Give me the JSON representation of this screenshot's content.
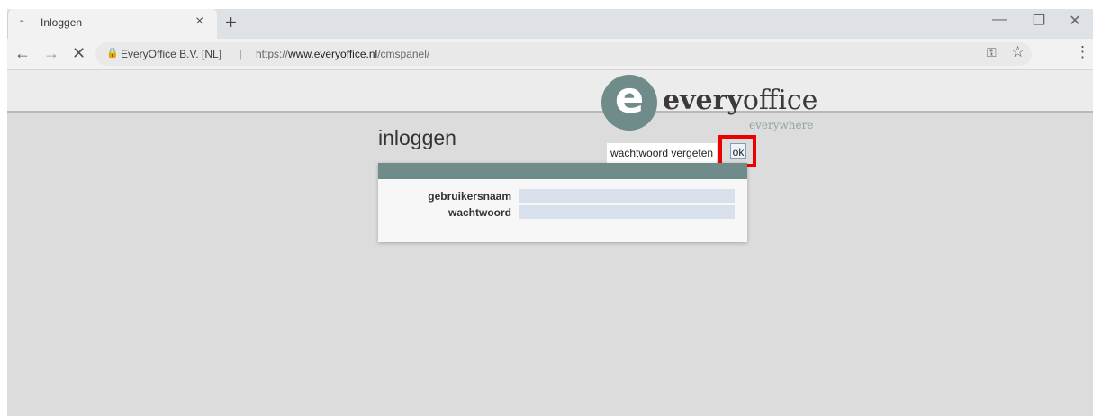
{
  "browser": {
    "tab": {
      "title": "Inloggen"
    },
    "address": {
      "site_identity": "EveryOffice B.V. [NL]",
      "separator": "|",
      "url_scheme": "https://",
      "url_host": "www.everyoffice.nl",
      "url_path": "/cmspanel/"
    },
    "icons": {
      "back": "←",
      "forward": "→",
      "stop": "✕",
      "lock": "🔒",
      "key": "⚿",
      "star": "☆",
      "menu": "⋮",
      "new_tab": "+",
      "tab_close": "×",
      "minimize": "—",
      "restore": "❐",
      "close": "✕",
      "favicon": "⁃"
    }
  },
  "logo": {
    "mark": "e",
    "word_bold": "every",
    "word_rest": "office",
    "tagline": "everywhere",
    "color": "#6f8b8a"
  },
  "login": {
    "title": "inloggen",
    "forgot_password_text": "wachtwoord vergeten",
    "ok_label": "ok",
    "username_label": "gebruikersnaam",
    "username_value": "",
    "password_label": "wachtwoord",
    "password_value": ""
  },
  "colors": {
    "panel_bar": "#6f8b8a",
    "input_bg": "#d8e1ec",
    "highlight": "#ee0000"
  }
}
